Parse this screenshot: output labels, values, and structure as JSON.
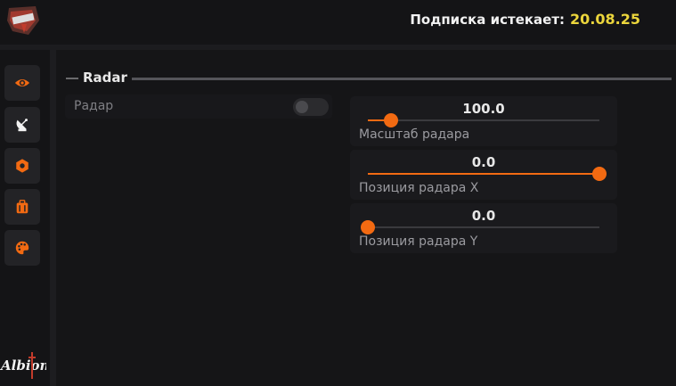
{
  "header": {
    "subscription_label": "Подписка истекает:",
    "subscription_date": "20.08.25"
  },
  "sidebar": {
    "items": [
      {
        "icon": "eye-icon"
      },
      {
        "icon": "radar-dish-icon"
      },
      {
        "icon": "hexagon-icon"
      },
      {
        "icon": "suitcase-icon"
      },
      {
        "icon": "palette-icon"
      }
    ],
    "accent": "#f26a12"
  },
  "section": {
    "title": "Radar"
  },
  "radar_toggle": {
    "label": "Радар",
    "enabled": false
  },
  "sliders": [
    {
      "value": "100.0",
      "label": "Масштаб радара",
      "fill_fraction": 0.1
    },
    {
      "value": "0.0",
      "label": "Позиция радара X",
      "fill_fraction": 1.0
    },
    {
      "value": "0.0",
      "label": "Позиция радара Y",
      "fill_fraction": 0.0
    }
  ],
  "colors": {
    "accent": "#f26a12",
    "date": "#ecd63c",
    "background": "#151517"
  }
}
